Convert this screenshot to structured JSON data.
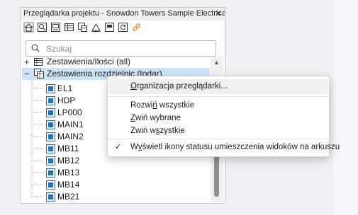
{
  "panel": {
    "title": "Przeglądarka projektu - Snowdon Towers Sample Electrical...",
    "close_glyph": "✕",
    "toolbar": [
      {
        "icon": "home-icon"
      },
      {
        "icon": "zoom-icon"
      },
      {
        "icon": "sheet-icon"
      },
      {
        "icon": "table-icon"
      },
      {
        "icon": "schedule-icon"
      },
      {
        "icon": "legend-icon"
      },
      {
        "icon": "view-icon"
      },
      {
        "icon": "refresh-icon"
      },
      {
        "icon": "link-icon"
      }
    ],
    "search": {
      "placeholder": "Szukaj",
      "value": ""
    },
    "tree": {
      "group1": {
        "expander": "+",
        "label": "Zestawienia/Ilości (all)"
      },
      "group2": {
        "expander": "−",
        "label": "Zestawienia rozdzielnic (todar)"
      },
      "leaves": [
        "EL1",
        "HDP",
        "LP000",
        "MAIN1",
        "MAIN2",
        "MB11",
        "MB12",
        "MB13",
        "MB14",
        "MB21"
      ]
    }
  },
  "menu": {
    "organize": {
      "pre": "",
      "ul": "O",
      "post": "rganizacja przeglądarki..."
    },
    "expand_all": {
      "pre": "Rozwi",
      "ul": "ń",
      "post": " wszystkie"
    },
    "collapse_selected": {
      "pre": "",
      "ul": "Z",
      "post": "wiń wybrane"
    },
    "collapse_all": {
      "pre": "Zwiń w",
      "ul": "s",
      "post": "zystkie"
    },
    "show_status": {
      "pre": "W",
      "ul": "y",
      "post": "świetl ikony statusu umieszczenia widoków na arkuszu",
      "check": "✓"
    }
  },
  "colors": {
    "selection": "#cce3f7",
    "accent": "#1e72c6",
    "link_icon": "#e8893a"
  }
}
